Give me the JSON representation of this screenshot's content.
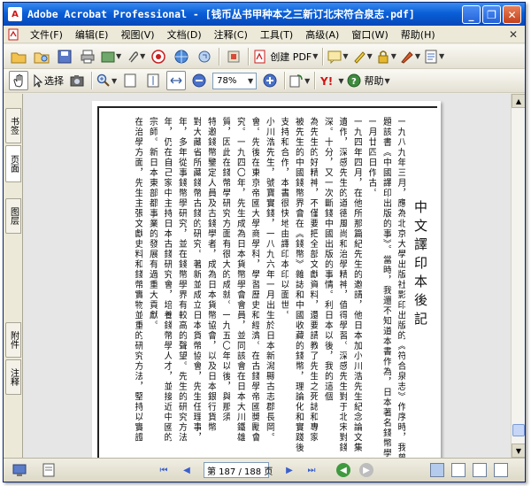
{
  "window": {
    "title": "Adobe Acrobat Professional - [钱币丛书甲种本之三新订北宋符合泉志.pdf]",
    "controls": [
      "_",
      "❐",
      "✕"
    ]
  },
  "menu": {
    "items": [
      "文件(F)",
      "编辑(E)",
      "视图(V)",
      "文档(D)",
      "注释(C)",
      "工具(T)",
      "高级(A)",
      "窗口(W)",
      "帮助(H)"
    ],
    "close": "✕"
  },
  "toolbar1": {
    "create_pdf": "创建 PDF"
  },
  "toolbar2": {
    "select": "选择",
    "zoom_value": "78%",
    "help": "帮助"
  },
  "left_tabs": {
    "bookmarks": "书签",
    "pages": "页面",
    "layers": "图层",
    "attachments": "附件",
    "comments": "注释"
  },
  "document": {
    "heading": "中文譯印本後記",
    "columns": [
      "一九八九年三月，應為北京大學出版社影印出版的《符合泉志》作序時，我曾",
      "題該書《中國譯印出版的事》。當時，我還不知道本書作為，日本著名錢幣學家小",
      "一月廿四日作古。",
      "一九四年四月，在他所那篇紀先生的邀請，他日本加小川浩先生紀念論文集",
      "遺作，深感先生的道德風尚和治學精神，值得學習。深感先生對于北宋對錢",
      "深。十分，又一次斷錢中國出版的事情。利日本以後，我的這個",
      "為先生的好精神，不僅要把全部文獻資料，還要請教了先生之死誌和專家",
      "被先生的中國錢幣界會在《錢幣》雜誌和中國收藏的錢幣，理論化和實踐後",
      "支持和合作，本書很快地由譯印本印以面世。",
      "小川浩先生，號寶實錢，一八九六年一月出生於日本新潟縣古志郡長岡。",
      "會。先後在東京帝國大學商學科，學習歷史和經濟。在古錢學帝國獎勵會",
      "究。一九四〇年，先生成為日本貨幣學會會員，並同該會在日本大川鐵雄",
      "質，因此在錢幣學研究方面有很大的成就。一九五〇年以後，與那須",
      "特邀錢幣鑒定人員及古錢學者，成為日本貨幣協會，以及日本銀行貨幣",
      "對大藏省所藏錢幣古錢的研究。著新並成立日本貨幣協會，先生任理事，",
      "年，多年從事錢幣學研究，並在錢幣學界有較高的聲望。先生的研究方法",
      "年，仍在自己家中主持日本古錢研究會，培養錢幣學人才，並接近中國的",
      "宗師。新日本東部都事業的發展有過重大貢獻。",
      "在治學方面，先生主張文獻史料和錢幣實物並重的研究方法，堅持以實證"
    ]
  },
  "statusbar": {
    "page_field": "第 187 / 188 页"
  },
  "colors": {
    "titlebar": "#0a5fd8",
    "chrome": "#ece9d8",
    "viewer_bg": "#e6e6e6"
  }
}
